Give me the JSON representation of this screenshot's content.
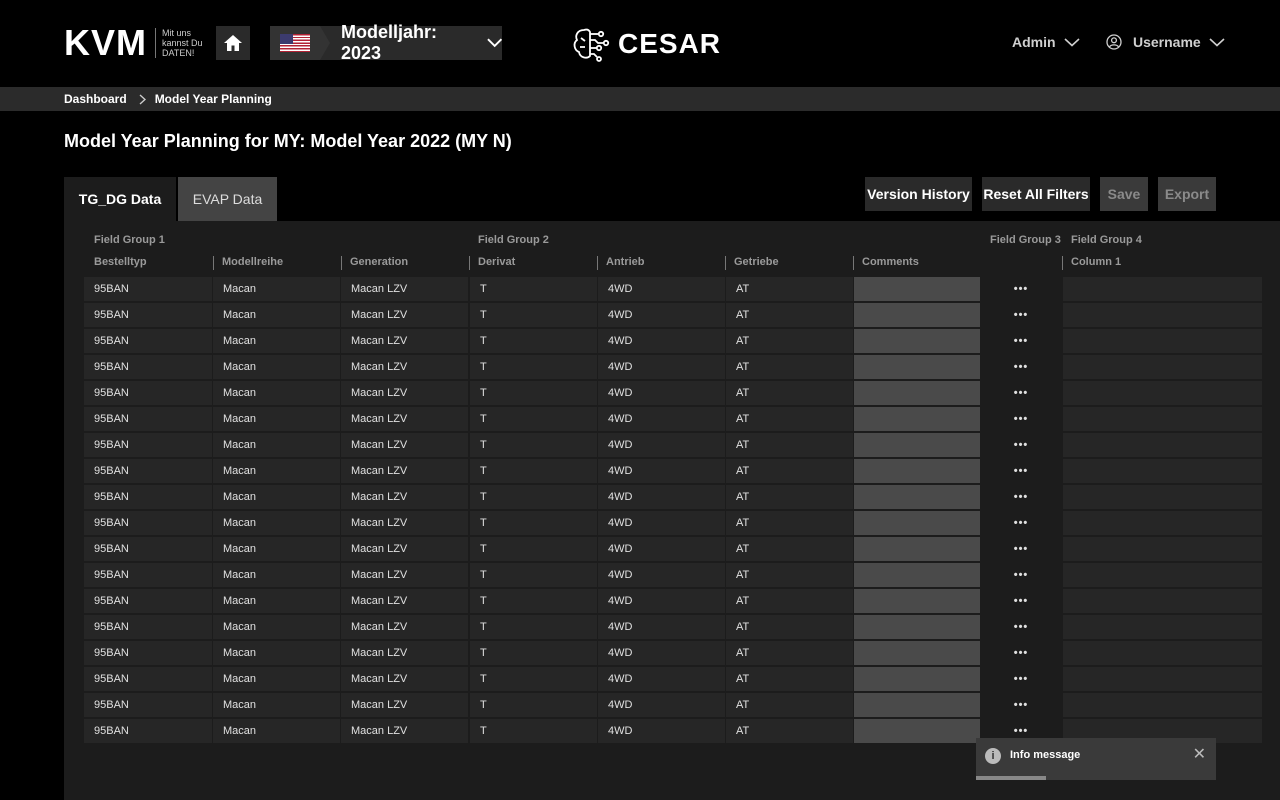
{
  "header": {
    "logo_text": "KVM",
    "logo_tagline": "Mit uns kannst Du DATEN!",
    "model_year_label": "Modelljahr: 2023",
    "brand_name": "CESAR",
    "admin_label": "Admin",
    "username_label": "Username"
  },
  "breadcrumb": {
    "items": [
      "Dashboard",
      "Model Year Planning"
    ]
  },
  "page": {
    "title": "Model Year Planning for MY: Model Year 2022 (MY N)"
  },
  "tabs": [
    {
      "label": "TG_DG Data",
      "active": true
    },
    {
      "label": "EVAP Data",
      "active": false
    }
  ],
  "actions": {
    "version_history": "Version History",
    "reset_filters": "Reset All Filters",
    "save": "Save",
    "export": "Export"
  },
  "table": {
    "groups": [
      "Field Group 1",
      "Field Group 2",
      "Field Group 3",
      "Field Group 4"
    ],
    "columns": [
      "Bestelltyp",
      "Modellreihe",
      "Generation",
      "Derivat",
      "Antrieb",
      "Getriebe",
      "Comments",
      "",
      "Column 1"
    ],
    "rows": [
      [
        "95BAN",
        "Macan",
        "Macan LZV",
        "T",
        "4WD",
        "AT"
      ],
      [
        "95BAN",
        "Macan",
        "Macan LZV",
        "T",
        "4WD",
        "AT"
      ],
      [
        "95BAN",
        "Macan",
        "Macan LZV",
        "T",
        "4WD",
        "AT"
      ],
      [
        "95BAN",
        "Macan",
        "Macan LZV",
        "T",
        "4WD",
        "AT"
      ],
      [
        "95BAN",
        "Macan",
        "Macan LZV",
        "T",
        "4WD",
        "AT"
      ],
      [
        "95BAN",
        "Macan",
        "Macan LZV",
        "T",
        "4WD",
        "AT"
      ],
      [
        "95BAN",
        "Macan",
        "Macan LZV",
        "T",
        "4WD",
        "AT"
      ],
      [
        "95BAN",
        "Macan",
        "Macan LZV",
        "T",
        "4WD",
        "AT"
      ],
      [
        "95BAN",
        "Macan",
        "Macan LZV",
        "T",
        "4WD",
        "AT"
      ],
      [
        "95BAN",
        "Macan",
        "Macan LZV",
        "T",
        "4WD",
        "AT"
      ],
      [
        "95BAN",
        "Macan",
        "Macan LZV",
        "T",
        "4WD",
        "AT"
      ],
      [
        "95BAN",
        "Macan",
        "Macan LZV",
        "T",
        "4WD",
        "AT"
      ],
      [
        "95BAN",
        "Macan",
        "Macan LZV",
        "T",
        "4WD",
        "AT"
      ],
      [
        "95BAN",
        "Macan",
        "Macan LZV",
        "T",
        "4WD",
        "AT"
      ],
      [
        "95BAN",
        "Macan",
        "Macan LZV",
        "T",
        "4WD",
        "AT"
      ],
      [
        "95BAN",
        "Macan",
        "Macan LZV",
        "T",
        "4WD",
        "AT"
      ],
      [
        "95BAN",
        "Macan",
        "Macan LZV",
        "T",
        "4WD",
        "AT"
      ],
      [
        "95BAN",
        "Macan",
        "Macan LZV",
        "T",
        "4WD",
        "AT"
      ]
    ],
    "row_menu_glyph": "•••"
  },
  "toast": {
    "message": "Info message",
    "icon": "info-icon",
    "progress": 0.29
  },
  "icons": {
    "home": "home-icon",
    "chevron": "chevron-down-icon",
    "user": "user-circle-icon",
    "brand": "circuit-brain-icon",
    "flag": "us-flag-icon"
  }
}
